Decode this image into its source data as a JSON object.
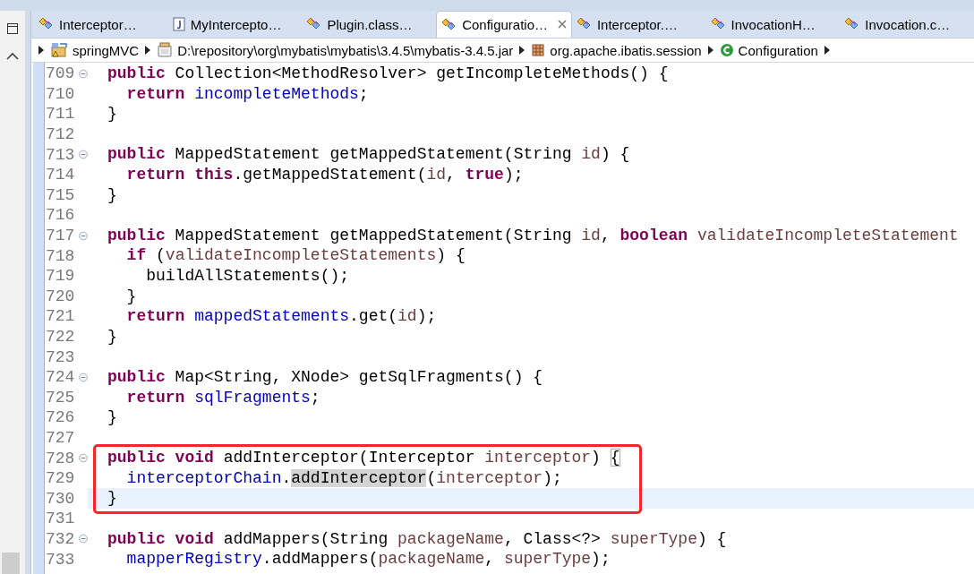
{
  "tabs": [
    {
      "label": "Interceptor…",
      "kind": "classfile",
      "selected": false,
      "closable": false
    },
    {
      "label": "MyIntercepto…",
      "kind": "source",
      "selected": false,
      "closable": false
    },
    {
      "label": "Plugin.class…",
      "kind": "classfile",
      "selected": false,
      "closable": false
    },
    {
      "label": "Configuratio…",
      "kind": "classfile",
      "selected": true,
      "closable": true
    },
    {
      "label": "Interceptor.…",
      "kind": "classfile",
      "selected": false,
      "closable": false
    },
    {
      "label": "InvocationH…",
      "kind": "classfile",
      "selected": false,
      "closable": false
    },
    {
      "label": "Invocation.c…",
      "kind": "classfile",
      "selected": false,
      "closable": false
    }
  ],
  "breadcrumb": [
    {
      "label": "springMVC",
      "kind": "project"
    },
    {
      "label": "D:\\repository\\org\\mybatis\\mybatis\\3.4.5\\mybatis-3.4.5.jar",
      "kind": "jar"
    },
    {
      "label": "org.apache.ibatis.session",
      "kind": "package"
    },
    {
      "label": "Configuration",
      "kind": "class"
    }
  ],
  "editor": {
    "lines": [
      {
        "number": "709",
        "foldable": true,
        "current": false,
        "framed": false,
        "tokens": [
          {
            "kind": "keyword",
            "text": "public"
          },
          {
            "kind": "plain",
            "text": " Collection<MethodResolver> getIncompleteMethods() {"
          }
        ]
      },
      {
        "number": "710",
        "foldable": false,
        "current": false,
        "framed": false,
        "tokens": [
          {
            "kind": "keyword",
            "text": "  return "
          },
          {
            "kind": "field",
            "text": "incompleteMethods"
          },
          {
            "kind": "plain",
            "text": ";"
          }
        ]
      },
      {
        "number": "711",
        "foldable": false,
        "current": false,
        "framed": false,
        "tokens": [
          {
            "kind": "plain",
            "text": "}"
          }
        ]
      },
      {
        "number": "712",
        "foldable": false,
        "current": false,
        "framed": false
      },
      {
        "number": "713",
        "foldable": true,
        "current": false,
        "framed": false,
        "tokens": [
          {
            "kind": "keyword",
            "text": "public"
          },
          {
            "kind": "plain",
            "text": " MappedStatement getMappedStatement(String "
          },
          {
            "kind": "param",
            "text": "id"
          },
          {
            "kind": "plain",
            "text": ") {"
          }
        ]
      },
      {
        "number": "714",
        "foldable": false,
        "current": false,
        "framed": false,
        "tokens": [
          {
            "kind": "keyword",
            "text": "  return this"
          },
          {
            "kind": "plain",
            "text": ".getMappedStatement("
          },
          {
            "kind": "param",
            "text": "id"
          },
          {
            "kind": "plain",
            "text": ", "
          },
          {
            "kind": "keyword",
            "text": "true"
          },
          {
            "kind": "plain",
            "text": ");"
          }
        ]
      },
      {
        "number": "715",
        "foldable": false,
        "current": false,
        "framed": false,
        "tokens": [
          {
            "kind": "plain",
            "text": "}"
          }
        ]
      },
      {
        "number": "716",
        "foldable": false,
        "current": false,
        "framed": false
      },
      {
        "number": "717",
        "foldable": true,
        "current": false,
        "framed": false,
        "tokens": [
          {
            "kind": "keyword",
            "text": "public"
          },
          {
            "kind": "plain",
            "text": " MappedStatement getMappedStatement(String "
          },
          {
            "kind": "param",
            "text": "id"
          },
          {
            "kind": "plain",
            "text": ", "
          },
          {
            "kind": "keyword",
            "text": "boolean "
          },
          {
            "kind": "param",
            "text": "validateIncompleteStatement"
          }
        ]
      },
      {
        "number": "718",
        "foldable": false,
        "current": false,
        "framed": false,
        "tokens": [
          {
            "kind": "keyword",
            "text": "  if"
          },
          {
            "kind": "plain",
            "text": " ("
          },
          {
            "kind": "param",
            "text": "validateIncompleteStatements"
          },
          {
            "kind": "plain",
            "text": ") {"
          }
        ]
      },
      {
        "number": "719",
        "foldable": false,
        "current": false,
        "framed": false,
        "tokens": [
          {
            "kind": "plain",
            "text": "    buildAllStatements();"
          }
        ]
      },
      {
        "number": "720",
        "foldable": false,
        "current": false,
        "framed": false,
        "tokens": [
          {
            "kind": "plain",
            "text": "  }"
          }
        ]
      },
      {
        "number": "721",
        "foldable": false,
        "current": false,
        "framed": false,
        "tokens": [
          {
            "kind": "keyword",
            "text": "  return "
          },
          {
            "kind": "field",
            "text": "mappedStatements"
          },
          {
            "kind": "plain",
            "text": ".get("
          },
          {
            "kind": "param",
            "text": "id"
          },
          {
            "kind": "plain",
            "text": ");"
          }
        ]
      },
      {
        "number": "722",
        "foldable": false,
        "current": false,
        "framed": false,
        "tokens": [
          {
            "kind": "plain",
            "text": "}"
          }
        ]
      },
      {
        "number": "723",
        "foldable": false,
        "current": false,
        "framed": false
      },
      {
        "number": "724",
        "foldable": true,
        "current": false,
        "framed": false,
        "tokens": [
          {
            "kind": "keyword",
            "text": "public"
          },
          {
            "kind": "plain",
            "text": " Map<String, XNode> getSqlFragments() {"
          }
        ]
      },
      {
        "number": "725",
        "foldable": false,
        "current": false,
        "framed": false,
        "tokens": [
          {
            "kind": "keyword",
            "text": "  return "
          },
          {
            "kind": "field",
            "text": "sqlFragments"
          },
          {
            "kind": "plain",
            "text": ";"
          }
        ]
      },
      {
        "number": "726",
        "foldable": false,
        "current": false,
        "framed": false,
        "tokens": [
          {
            "kind": "plain",
            "text": "}"
          }
        ]
      },
      {
        "number": "727",
        "foldable": false,
        "current": false,
        "framed": false
      },
      {
        "number": "728",
        "foldable": true,
        "current": false,
        "framed": true,
        "tokens": [
          {
            "kind": "keyword",
            "text": "public void"
          },
          {
            "kind": "plain",
            "text": " addInterceptor(Interceptor "
          },
          {
            "kind": "param",
            "text": "interceptor"
          },
          {
            "kind": "plain",
            "text": ") "
          },
          {
            "kind": "bracket_match",
            "text": "{"
          }
        ]
      },
      {
        "number": "729",
        "foldable": false,
        "current": false,
        "framed": true,
        "tokens": [
          {
            "kind": "field",
            "text": "  interceptorChain"
          },
          {
            "kind": "plain",
            "text": "."
          },
          {
            "kind": "occurrence",
            "text": "addInterceptor"
          },
          {
            "kind": "plain",
            "text": "("
          },
          {
            "kind": "param",
            "text": "interceptor"
          },
          {
            "kind": "plain",
            "text": ");"
          }
        ]
      },
      {
        "number": "730",
        "foldable": false,
        "current": true,
        "framed": true,
        "tokens": [
          {
            "kind": "plain",
            "text": "}"
          }
        ]
      },
      {
        "number": "731",
        "foldable": false,
        "current": false,
        "framed": false
      },
      {
        "number": "732",
        "foldable": true,
        "current": false,
        "framed": false,
        "tokens": [
          {
            "kind": "keyword",
            "text": "public void"
          },
          {
            "kind": "plain",
            "text": " addMappers(String "
          },
          {
            "kind": "param",
            "text": "packageName"
          },
          {
            "kind": "plain",
            "text": ", Class<?> "
          },
          {
            "kind": "param",
            "text": "superType"
          },
          {
            "kind": "plain",
            "text": ") {"
          }
        ]
      },
      {
        "number": "733",
        "foldable": false,
        "current": false,
        "framed": false,
        "tokens": [
          {
            "kind": "field",
            "text": "  mapperRegistry"
          },
          {
            "kind": "plain",
            "text": ".addMappers("
          },
          {
            "kind": "param",
            "text": "packageName"
          },
          {
            "kind": "plain",
            "text": ", "
          },
          {
            "kind": "param",
            "text": "superType"
          },
          {
            "kind": "plain",
            "text": ");"
          }
        ]
      }
    ]
  }
}
